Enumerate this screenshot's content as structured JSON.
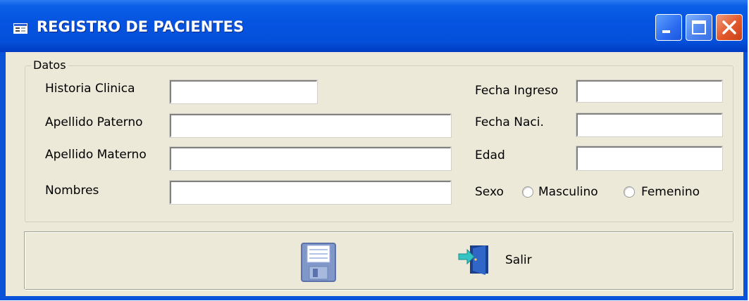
{
  "window": {
    "title": "REGISTRO DE PACIENTES",
    "icons": {
      "app": "form-icon",
      "minimize": "minimize-icon",
      "maximize": "maximize-icon",
      "close": "close-icon"
    }
  },
  "datos": {
    "legend": "Datos",
    "historia_clinica": {
      "label": "Historia Clinica",
      "value": ""
    },
    "apellido_paterno": {
      "label": "Apellido Paterno",
      "value": ""
    },
    "apellido_materno": {
      "label": "Apellido Materno",
      "value": ""
    },
    "nombres": {
      "label": "Nombres",
      "value": ""
    },
    "fecha_ingreso": {
      "label": "Fecha Ingreso",
      "value": ""
    },
    "fecha_naci": {
      "label": "Fecha Naci.",
      "value": ""
    },
    "edad": {
      "label": "Edad",
      "value": ""
    },
    "sexo": {
      "label": "Sexo",
      "options": [
        "Masculino",
        "Femenino"
      ],
      "selected": null
    }
  },
  "actions": {
    "save_icon": "floppy-disk-icon",
    "exit_icon": "exit-door-icon",
    "salir_label": "Salir"
  },
  "colors": {
    "titlebar": "#0553e0",
    "client_bg": "#ece9d8",
    "close_button": "#e2572a"
  }
}
